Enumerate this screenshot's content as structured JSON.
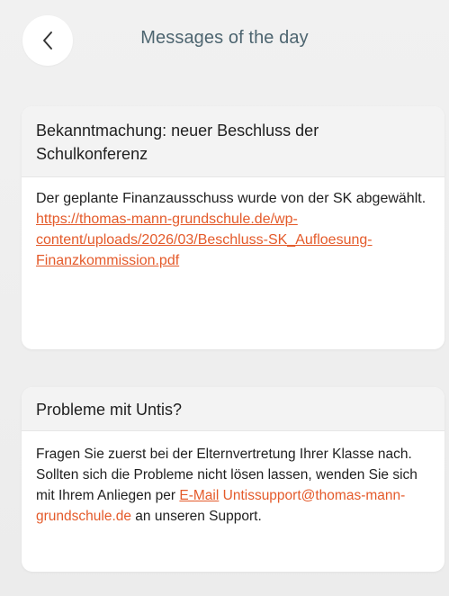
{
  "header": {
    "back_icon": "chevron-left-icon",
    "title": "Messages of the day"
  },
  "colors": {
    "link": "#e45a2a",
    "title": "#4d6570"
  },
  "messages": [
    {
      "title": "Bekanntmachung: neuer Beschluss der Schulkonferenz",
      "body": "Der geplante Finanzausschuss wurde von der SK abgewählt.",
      "link": "https://thomas-mann-grundschule.de/wp-content/uploads/2026/03/Beschluss-SK_Aufloesung-Finanzkommission.pdf"
    },
    {
      "title": "Probleme mit Untis?",
      "body_before": "Fragen Sie zuerst bei der Elternvertretung Ihrer Klasse nach. Sollten sich die Probleme nicht lösen lassen, wenden Sie sich mit Ihrem Anliegen per ",
      "email_link": "E-Mail",
      "email_address": "Untissupport@thomas-mann-grundschule.de",
      "body_after": " an unseren Support."
    }
  ]
}
